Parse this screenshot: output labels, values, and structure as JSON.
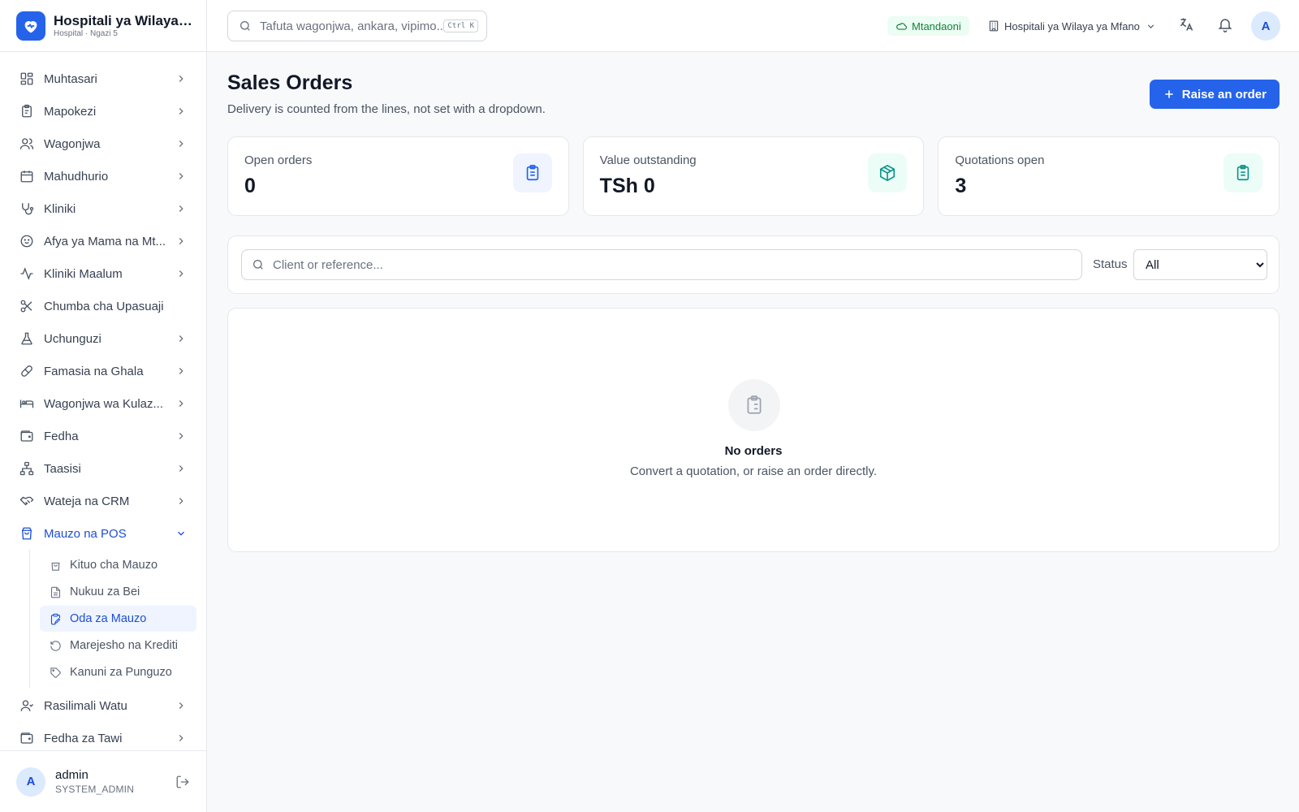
{
  "app": {
    "name": "Hospitali ya Wilaya ...",
    "subtitle": "Hospital · Ngazi 5"
  },
  "topbar": {
    "search_placeholder": "Tafuta wagonjwa, ankara, vipimo...",
    "shortcut": "Ctrl K",
    "status": "Mtandaoni",
    "facility": "Hospitali ya Wilaya ya Mfano",
    "avatar_initial": "A"
  },
  "sidebar": {
    "items": [
      {
        "label": "Muhtasari",
        "icon": "dashboard-icon"
      },
      {
        "label": "Mapokezi",
        "icon": "clipboard-icon"
      },
      {
        "label": "Wagonjwa",
        "icon": "users-icon"
      },
      {
        "label": "Mahudhurio",
        "icon": "calendar-icon"
      },
      {
        "label": "Kliniki",
        "icon": "stethoscope-icon"
      },
      {
        "label": "Afya ya Mama na Mt...",
        "icon": "baby-icon"
      },
      {
        "label": "Kliniki Maalum",
        "icon": "activity-icon"
      },
      {
        "label": "Chumba cha Upasuaji",
        "icon": "scissors-icon"
      },
      {
        "label": "Uchunguzi",
        "icon": "flask-icon"
      },
      {
        "label": "Famasia na Ghala",
        "icon": "pill-icon"
      },
      {
        "label": "Wagonjwa wa Kulaz...",
        "icon": "bed-icon"
      },
      {
        "label": "Fedha",
        "icon": "wallet-icon"
      },
      {
        "label": "Taasisi",
        "icon": "org-chart-icon"
      },
      {
        "label": "Wateja na CRM",
        "icon": "handshake-icon"
      },
      {
        "label": "Mauzo na POS",
        "icon": "shopping-bag-icon"
      }
    ],
    "sub_items": [
      {
        "label": "Kituo cha Mauzo",
        "icon": "shopping-bag-icon"
      },
      {
        "label": "Nukuu za Bei",
        "icon": "file-text-icon"
      },
      {
        "label": "Oda za Mauzo",
        "icon": "clipboard-edit-icon"
      },
      {
        "label": "Marejesho na Krediti",
        "icon": "undo-icon"
      },
      {
        "label": "Kanuni za Punguzo",
        "icon": "tag-icon"
      }
    ],
    "bottom_items": [
      {
        "label": "Rasilimali Watu",
        "icon": "user-icon"
      },
      {
        "label": "Fedha za Tawi",
        "icon": "wallet-icon"
      }
    ],
    "user": {
      "initial": "A",
      "name": "admin",
      "role": "SYSTEM_ADMIN"
    }
  },
  "page": {
    "title": "Sales Orders",
    "subtitle": "Delivery is counted from the lines, not set with a dropdown.",
    "primary_action": "Raise an order"
  },
  "stats": [
    {
      "label": "Open orders",
      "value": "0",
      "icon": "clipboard-list-icon",
      "accent": "#2563eb",
      "bg": "#eff4ff"
    },
    {
      "label": "Value outstanding",
      "value": "TSh 0",
      "icon": "package-icon",
      "accent": "#0d9488",
      "bg": "#ecfdf8"
    },
    {
      "label": "Quotations open",
      "value": "3",
      "icon": "clipboard-list-icon",
      "accent": "#0d9488",
      "bg": "#ecfdf8"
    }
  ],
  "filters": {
    "search_placeholder": "Client or reference...",
    "status_label": "Status",
    "status_value": "All"
  },
  "empty_state": {
    "title": "No orders",
    "message": "Convert a quotation, or raise an order directly."
  },
  "colors": {
    "primary": "#2563eb",
    "active_text": "#1d4ed8",
    "online": "#15803d"
  }
}
